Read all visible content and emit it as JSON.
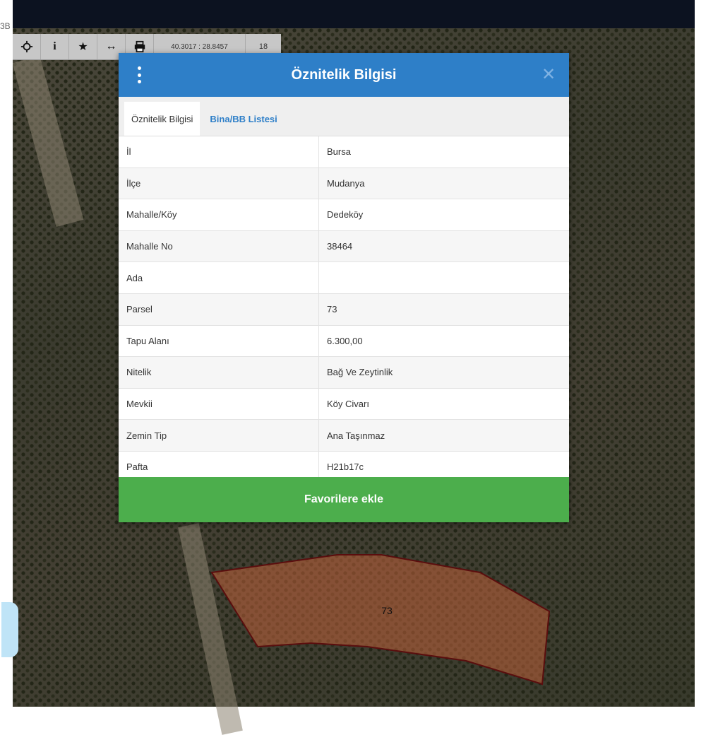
{
  "corner_label": "3B",
  "toolbar": {
    "coords": "40.3017 : 28.8457",
    "zoom": "18"
  },
  "modal": {
    "title": "Öznitelik Bilgisi",
    "tabs": [
      {
        "label": "Öznitelik Bilgisi"
      },
      {
        "label": "Bina/BB Listesi"
      }
    ],
    "rows": [
      {
        "key": "İl",
        "value": "Bursa"
      },
      {
        "key": "İlçe",
        "value": "Mudanya"
      },
      {
        "key": "Mahalle/Köy",
        "value": "Dedeköy"
      },
      {
        "key": "Mahalle No",
        "value": "38464"
      },
      {
        "key": "Ada",
        "value": ""
      },
      {
        "key": "Parsel",
        "value": "73"
      },
      {
        "key": "Tapu Alanı",
        "value": "6.300,00"
      },
      {
        "key": "Nitelik",
        "value": "Bağ Ve Zeytinlik"
      },
      {
        "key": "Mevkii",
        "value": "Köy Civarı"
      },
      {
        "key": "Zemin Tip",
        "value": "Ana Taşınmaz"
      },
      {
        "key": "Pafta",
        "value": "H21b17c"
      }
    ],
    "favorite_button": "Favorilere ekle"
  },
  "map": {
    "parcel_label": "73",
    "parcel_color": "#c0603a",
    "parcel_border": "#5a0e0e"
  },
  "colors": {
    "header": "#2e7fc8",
    "button": "#4cae4c"
  }
}
